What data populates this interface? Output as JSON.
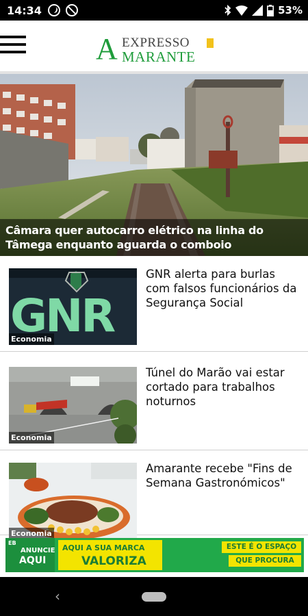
{
  "status_bar": {
    "time": "14:34",
    "battery_percent": "53%",
    "icons": [
      "app-notification-icon",
      "blocked-notification-icon",
      "bluetooth-icon",
      "wifi-icon",
      "signal-icon",
      "battery-icon"
    ]
  },
  "header": {
    "menu_icon": "hamburger-menu-icon",
    "logo": {
      "initial": "A",
      "top": "EXPRESSO",
      "bottom": "MARANTE"
    },
    "brand_color": "#1f9c3b"
  },
  "hero": {
    "title": "Câmara quer autocarro elétrico na linha do Tâmega enquanto aguarda o comboio"
  },
  "articles": [
    {
      "category": "Economia",
      "title": "GNR alerta para burlas com falsos funcionários da Segurança Social"
    },
    {
      "category": "Economia",
      "title": "Túnel do Marão vai estar cortado para trabalhos noturnos"
    },
    {
      "category": "Economia",
      "title": "Amarante recebe \"Fins de Semana Gastronómicos\""
    }
  ],
  "ad": {
    "small": "EB",
    "left_line1": "ANUNCIE",
    "left_line2": "AQUI",
    "mid_line1": "AQUI A SUA MARCA",
    "mid_line2": "VALORIZA",
    "right_line1": "ESTE É O ESPAÇO",
    "right_line2": "QUE PROCURA"
  },
  "nav_bar": {
    "back": "‹"
  }
}
